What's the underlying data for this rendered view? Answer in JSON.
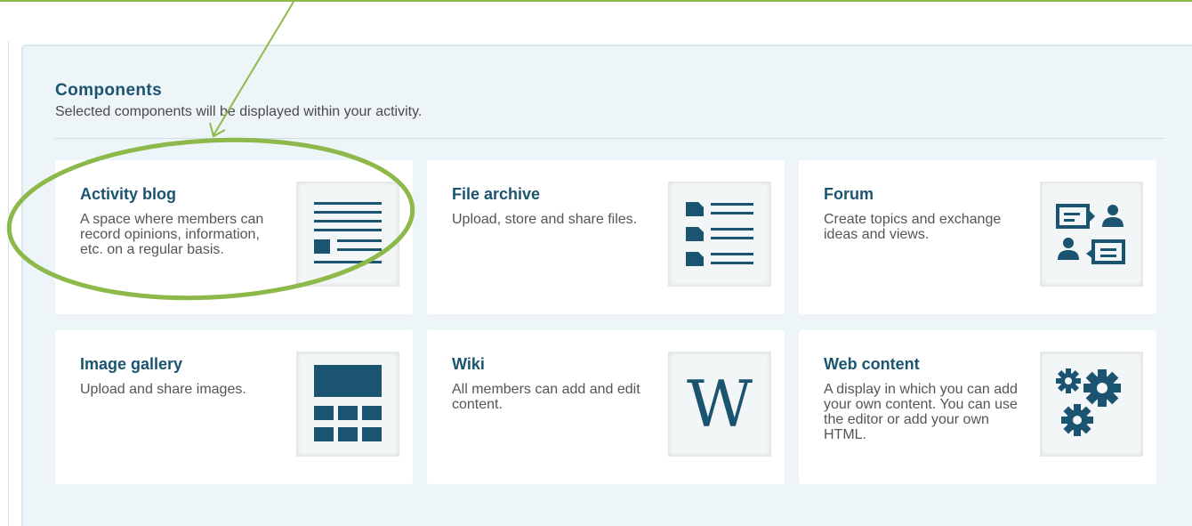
{
  "section": {
    "title": "Components",
    "subtitle": "Selected components will be displayed within your activity."
  },
  "components": [
    {
      "title": "Activity blog",
      "description": "A space where members can record opinions, information, etc. on a regular basis.",
      "icon": "blog-icon"
    },
    {
      "title": "File archive",
      "description": "Upload, store and share files.",
      "icon": "file-list-icon"
    },
    {
      "title": "Forum",
      "description": "Create topics and exchange ideas and views.",
      "icon": "forum-icon"
    },
    {
      "title": "Image gallery",
      "description": "Upload and share images.",
      "icon": "gallery-icon"
    },
    {
      "title": "Wiki",
      "description": "All members can add and edit content.",
      "icon": "wiki-icon",
      "glyph": "W"
    },
    {
      "title": "Web content",
      "description": "A display in which you can add your own content. You can use the editor or add your own HTML.",
      "icon": "gears-icon"
    }
  ],
  "colors": {
    "accent": "#1b5470",
    "annotation": "#8db84a",
    "panel_bg": "#eef5f8"
  }
}
